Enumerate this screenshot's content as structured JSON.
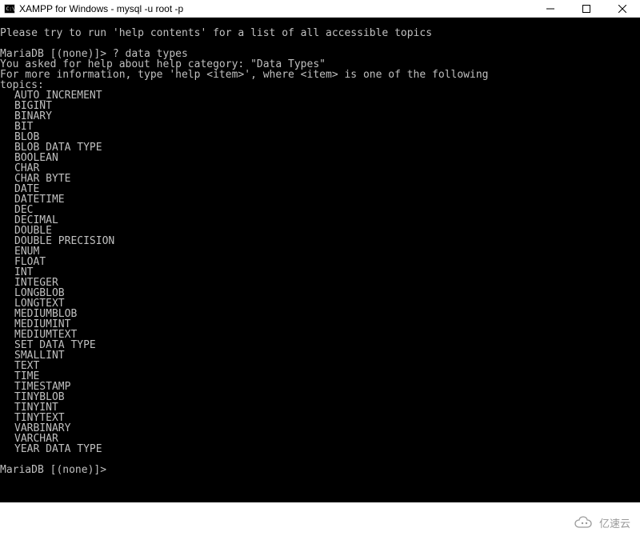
{
  "window": {
    "title": "XAMPP for Windows - mysql -u root -p"
  },
  "terminal": {
    "line_hint": "Please try to run 'help contents' for a list of all accessible topics",
    "prompt1": "MariaDB [(none)]> ? data types",
    "asked": "You asked for help about help category: \"Data Types\"",
    "more_info": "For more information, type 'help <item>', where <item> is one of the following",
    "topics_label": "topics:",
    "types": [
      "AUTO_INCREMENT",
      "BIGINT",
      "BINARY",
      "BIT",
      "BLOB",
      "BLOB DATA TYPE",
      "BOOLEAN",
      "CHAR",
      "CHAR BYTE",
      "DATE",
      "DATETIME",
      "DEC",
      "DECIMAL",
      "DOUBLE",
      "DOUBLE PRECISION",
      "ENUM",
      "FLOAT",
      "INT",
      "INTEGER",
      "LONGBLOB",
      "LONGTEXT",
      "MEDIUMBLOB",
      "MEDIUMINT",
      "MEDIUMTEXT",
      "SET DATA TYPE",
      "SMALLINT",
      "TEXT",
      "TIME",
      "TIMESTAMP",
      "TINYBLOB",
      "TINYINT",
      "TINYTEXT",
      "VARBINARY",
      "VARCHAR",
      "YEAR DATA TYPE"
    ],
    "prompt2": "MariaDB [(none)]> "
  },
  "watermark": {
    "text": "亿速云"
  }
}
